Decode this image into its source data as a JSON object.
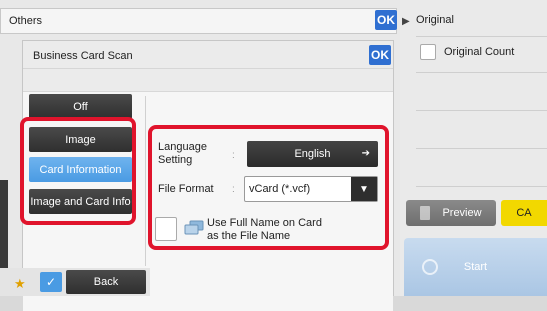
{
  "others": {
    "title": "Others",
    "ok_label": "OK"
  },
  "right_panel": {
    "title": "Original",
    "original_count_label": "Original Count",
    "preview_label": "Preview",
    "ca_label": "CA",
    "start_label": "Start"
  },
  "dialog": {
    "title": "Business Card Scan",
    "ok_label": "OK",
    "off_label": "Off",
    "mode_options": [
      "Image",
      "Card Information",
      "Image and Card Info"
    ],
    "selected_mode": "Card Information",
    "language_label": "Language\nSetting",
    "language_value": "English",
    "file_format_label": "File Format",
    "file_format_value": "vCard (*.vcf)",
    "full_name_label": "Use Full Name on Card\nas the File Name"
  },
  "bottom": {
    "back_label": "Back"
  },
  "colors": {
    "accent_blue": "#2f6fd1",
    "highlight_red": "#e0142c",
    "ca_yellow": "#f2d800"
  }
}
